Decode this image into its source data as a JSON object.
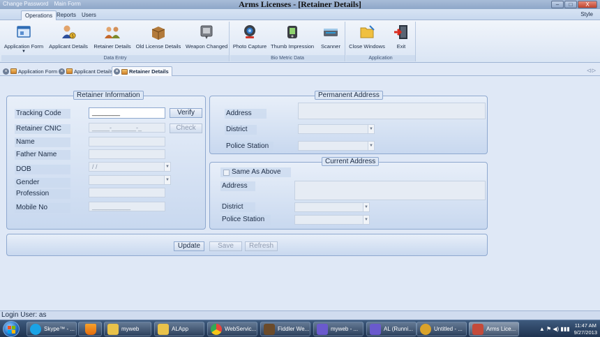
{
  "window": {
    "title": "Arms Licenses - [Retainer Details]",
    "top_links": [
      "Change Password",
      "Main Form"
    ],
    "controls": {
      "minimize": "–",
      "maximize": "□",
      "close": "X"
    }
  },
  "menu": {
    "tabs": [
      "Operations",
      "Reports",
      "Users"
    ],
    "style": "Style"
  },
  "ribbon": {
    "groups": [
      {
        "title": "Data Entry",
        "buttons": [
          {
            "label": "Application Form",
            "icon": "application-form-icon",
            "dropdown": "▼"
          },
          {
            "label": "Applicant Details",
            "icon": "applicant-details-icon"
          },
          {
            "label": "Retainer Details",
            "icon": "retainer-details-icon"
          },
          {
            "label": "Old License Details",
            "icon": "old-license-icon"
          },
          {
            "label": "Weapon Changed",
            "icon": "weapon-changed-icon"
          }
        ]
      },
      {
        "title": "Bio Metric Data",
        "buttons": [
          {
            "label": "Photo Capture",
            "icon": "webcam-icon"
          },
          {
            "label": "Thumb Impression",
            "icon": "fingerprint-scanner-icon"
          },
          {
            "label": "Scanner",
            "icon": "scanner-icon"
          }
        ]
      },
      {
        "title": "Application",
        "buttons": [
          {
            "label": "Close Windows",
            "icon": "close-windows-icon"
          },
          {
            "label": "Exit",
            "icon": "exit-icon"
          }
        ]
      }
    ]
  },
  "doc_tabs": [
    {
      "label": "Application Form",
      "active": false
    },
    {
      "label": "Applicant Details",
      "active": false
    },
    {
      "label": "Retainer Details",
      "active": true
    }
  ],
  "doc_nav": "◁ ▷",
  "retainer": {
    "legend": "Retainer Information",
    "tracking_code": {
      "label": "Tracking Code",
      "value": "________"
    },
    "verify": "Verify",
    "cnic": {
      "label": "Retainer CNIC",
      "placeholder": "_____-_______-_"
    },
    "check": "Check",
    "name": {
      "label": "Name",
      "value": ""
    },
    "father_name": {
      "label": "Father Name",
      "value": ""
    },
    "dob": {
      "label": "DOB",
      "value": "  /  /"
    },
    "gender": {
      "label": "Gender",
      "value": ""
    },
    "profession": {
      "label": "Profession",
      "value": ""
    },
    "mobile": {
      "label": "Mobile No",
      "placeholder": "___________"
    }
  },
  "permanent": {
    "legend": "Permanent Address",
    "address_label": "Address",
    "district_label": "District",
    "police_label": "Police Station"
  },
  "current": {
    "legend": "Current Address",
    "same_as_above": "Same As Above",
    "address_label": "Address",
    "district_label": "District",
    "police_label": "Police Station"
  },
  "actions": {
    "update": "Update",
    "save": "Save",
    "refresh": "Refresh"
  },
  "status": {
    "text": "Login User: as"
  },
  "taskbar": {
    "items": [
      {
        "label": "Skype™ - ...",
        "color": "#1aa3e6"
      },
      {
        "label": "",
        "color": "#f28c1b"
      },
      {
        "label": "myweb",
        "color": "#e9c24a"
      },
      {
        "label": "ALApp",
        "color": "#e9c24a"
      },
      {
        "label": "WebServic...",
        "color": "#e8453c"
      },
      {
        "label": "Fiddler We...",
        "color": "#6b4b2a"
      },
      {
        "label": "myweb - ...",
        "color": "#6a5acd"
      },
      {
        "label": "AL (Runni...",
        "color": "#6a5acd"
      },
      {
        "label": "Untitled - ...",
        "color": "#d9a22b"
      },
      {
        "label": "Arms Lice...",
        "color": "#c44a3a",
        "active": true
      }
    ],
    "tray_icons": "▲  ⚑  ◀)  ▮▮▮",
    "time": "11:47 AM",
    "date": "9/27/2013"
  }
}
